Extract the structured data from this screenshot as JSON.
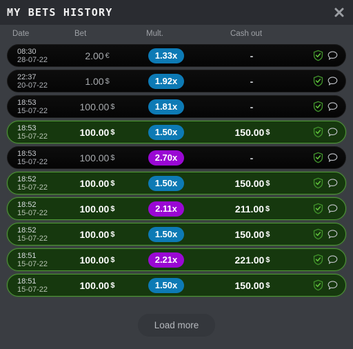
{
  "window": {
    "title": "MY BETS HISTORY",
    "close_icon": "close-icon",
    "accent_blue": "#0d7ab5",
    "accent_purple": "#9a08d4",
    "win_green": "#16380e",
    "win_border": "#4f9a35",
    "panel_bg": "#3a3d42",
    "titlebar_bg": "#2a2c31"
  },
  "columns": {
    "date": "Date",
    "bet": "Bet",
    "mult": "Mult.",
    "cashout": "Cash out"
  },
  "rows": [
    {
      "time": "08:30",
      "day": "28-07-22",
      "bet_amount": "2.00",
      "bet_currency": "€",
      "mult": "1.33x",
      "mult_color": "blue",
      "cashout": "-",
      "cashout_currency": "",
      "result": "loss",
      "shield_icon": "shield-check-icon",
      "chat_icon": "chat-bubble-icon"
    },
    {
      "time": "22:37",
      "day": "20-07-22",
      "bet_amount": "1.00",
      "bet_currency": "$",
      "mult": "1.92x",
      "mult_color": "blue",
      "cashout": "-",
      "cashout_currency": "",
      "result": "loss",
      "shield_icon": "shield-check-icon",
      "chat_icon": "chat-bubble-icon"
    },
    {
      "time": "18:53",
      "day": "15-07-22",
      "bet_amount": "100.00",
      "bet_currency": "$",
      "mult": "1.81x",
      "mult_color": "blue",
      "cashout": "-",
      "cashout_currency": "",
      "result": "loss",
      "shield_icon": "shield-check-icon",
      "chat_icon": "chat-bubble-icon"
    },
    {
      "time": "18:53",
      "day": "15-07-22",
      "bet_amount": "100.00",
      "bet_currency": "$",
      "mult": "1.50x",
      "mult_color": "blue",
      "cashout": "150.00",
      "cashout_currency": "$",
      "result": "win",
      "shield_icon": "shield-check-icon",
      "chat_icon": "chat-bubble-icon"
    },
    {
      "time": "18:53",
      "day": "15-07-22",
      "bet_amount": "100.00",
      "bet_currency": "$",
      "mult": "2.70x",
      "mult_color": "purple",
      "cashout": "-",
      "cashout_currency": "",
      "result": "loss",
      "shield_icon": "shield-check-icon",
      "chat_icon": "chat-bubble-icon"
    },
    {
      "time": "18:52",
      "day": "15-07-22",
      "bet_amount": "100.00",
      "bet_currency": "$",
      "mult": "1.50x",
      "mult_color": "blue",
      "cashout": "150.00",
      "cashout_currency": "$",
      "result": "win",
      "shield_icon": "shield-check-icon",
      "chat_icon": "chat-bubble-icon"
    },
    {
      "time": "18:52",
      "day": "15-07-22",
      "bet_amount": "100.00",
      "bet_currency": "$",
      "mult": "2.11x",
      "mult_color": "purple",
      "cashout": "211.00",
      "cashout_currency": "$",
      "result": "win",
      "shield_icon": "shield-check-icon",
      "chat_icon": "chat-bubble-icon"
    },
    {
      "time": "18:52",
      "day": "15-07-22",
      "bet_amount": "100.00",
      "bet_currency": "$",
      "mult": "1.50x",
      "mult_color": "blue",
      "cashout": "150.00",
      "cashout_currency": "$",
      "result": "win",
      "shield_icon": "shield-check-icon",
      "chat_icon": "chat-bubble-icon"
    },
    {
      "time": "18:51",
      "day": "15-07-22",
      "bet_amount": "100.00",
      "bet_currency": "$",
      "mult": "2.21x",
      "mult_color": "purple",
      "cashout": "221.00",
      "cashout_currency": "$",
      "result": "win",
      "shield_icon": "shield-check-icon",
      "chat_icon": "chat-bubble-icon"
    },
    {
      "time": "18:51",
      "day": "15-07-22",
      "bet_amount": "100.00",
      "bet_currency": "$",
      "mult": "1.50x",
      "mult_color": "blue",
      "cashout": "150.00",
      "cashout_currency": "$",
      "result": "win",
      "shield_icon": "shield-check-icon",
      "chat_icon": "chat-bubble-icon"
    }
  ],
  "footer": {
    "load_more": "Load more"
  }
}
